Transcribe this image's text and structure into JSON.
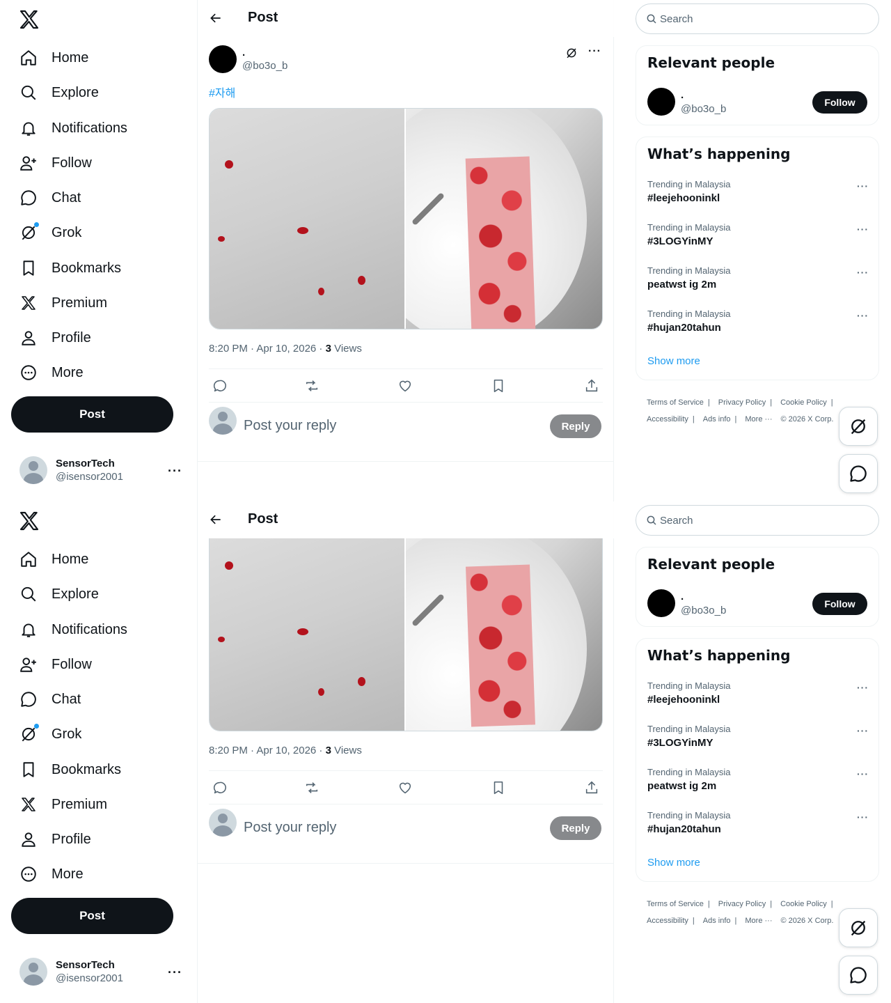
{
  "nav": {
    "items": [
      {
        "label": "Home",
        "icon": "home-icon"
      },
      {
        "label": "Explore",
        "icon": "search-icon"
      },
      {
        "label": "Notifications",
        "icon": "bell-icon"
      },
      {
        "label": "Follow",
        "icon": "add-user-icon"
      },
      {
        "label": "Chat",
        "icon": "chat-icon"
      },
      {
        "label": "Grok",
        "icon": "grok-icon"
      },
      {
        "label": "Bookmarks",
        "icon": "bookmark-icon"
      },
      {
        "label": "Premium",
        "icon": "x-logo-icon"
      },
      {
        "label": "Profile",
        "icon": "person-icon"
      },
      {
        "label": "More",
        "icon": "more-circle-icon"
      }
    ],
    "post_label": "Post"
  },
  "account": {
    "name": "SensorTech",
    "handle": "@isensor2001",
    "more": "···"
  },
  "header": {
    "title": "Post"
  },
  "post": {
    "author_name": ".",
    "author_handle": "@bo3o_b",
    "hashtag": "#자해",
    "time": "8:20 PM · Apr 10, 2026 · ",
    "views_count": "3",
    "views_label": " Views",
    "more": "···"
  },
  "reply": {
    "placeholder": "Post your reply",
    "button": "Reply"
  },
  "search": {
    "placeholder": "Search"
  },
  "relevant": {
    "title": "Relevant people",
    "name": ".",
    "handle": "@bo3o_b",
    "follow": "Follow"
  },
  "happening": {
    "title": "What’s happening",
    "trends": [
      {
        "meta": "Trending in Malaysia",
        "name": "#leejehooninkl"
      },
      {
        "meta": "Trending in Malaysia",
        "name": "#3LOGYinMY"
      },
      {
        "meta": "Trending in Malaysia",
        "name": "peatwst ig 2m"
      },
      {
        "meta": "Trending in Malaysia",
        "name": "#hujan20tahun"
      }
    ],
    "show_more": "Show more",
    "more": "···"
  },
  "footer": {
    "terms": "Terms of Service",
    "privacy": "Privacy Policy",
    "cookie": "Cookie Policy",
    "accessibility": "Accessibility",
    "ads": "Ads info",
    "more": "More ···",
    "copyright": "© 2026 X Corp."
  },
  "colors": {
    "accent": "#1d9bf0",
    "text": "#0f1419",
    "muted": "#536471",
    "border": "#eff3f4",
    "button_dark": "#0f1419",
    "reply_disabled": "#87898c"
  }
}
